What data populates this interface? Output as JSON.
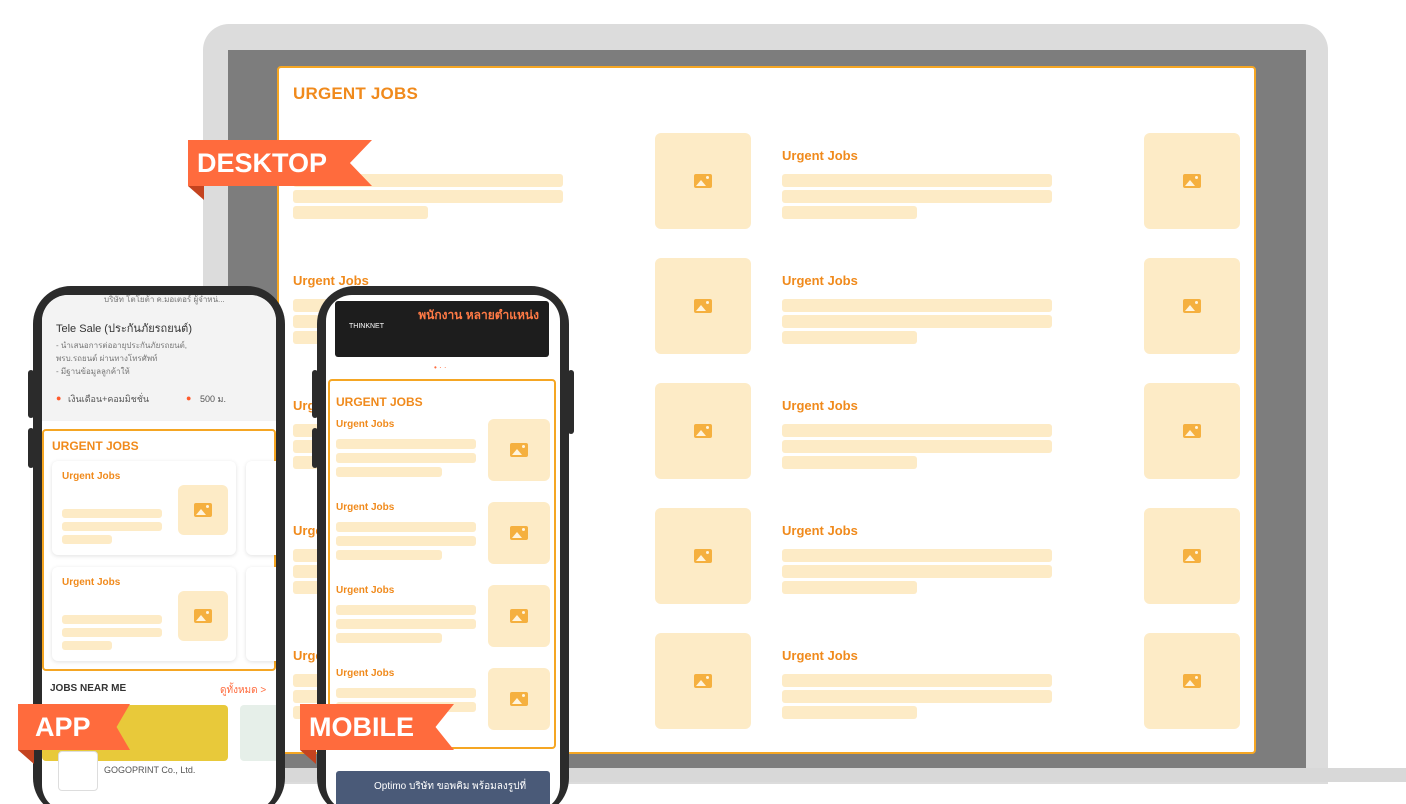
{
  "labels": {
    "desktop": "DESKTOP",
    "app": "APP",
    "mobile": "MOBILE"
  },
  "desktop": {
    "title": "URGENT JOBS",
    "card_label": "Urgent Jobs"
  },
  "app": {
    "company_line": "บริษัท โตโยต้า ค.มอเตอร์ ผู้จำหน่...",
    "job_title": "Tele Sale (ประกันภัยรถยนต์)",
    "job_desc": [
      "- นำเสนอการต่ออายุประกันภัยรถยนต์,",
      "พรบ.รถยนต์ ผ่านทางโทรศัพท์",
      "- มีฐานข้อมูลลูกค้าให้"
    ],
    "salary": "เงินเดือน+คอมมิชชั่น",
    "distance": "500 ม.",
    "urgent_title": "URGENT JOBS",
    "card_label": "Urgent Jobs",
    "near_title": "JOBS NEAR ME",
    "near_link": "ดูทั้งหมด >",
    "company": "GOGOPRINT Co., Ltd."
  },
  "mobile": {
    "banner_title": "พนักงาน หลายตำแหน่ง",
    "banner_brand": "THINKNET",
    "urgent_title": "URGENT JOBS",
    "card_label": "Urgent Jobs",
    "bottom_text": "Optimo บริษัท ขอพคิม พร้อมลงรูปที่"
  },
  "colors": {
    "accent": "#f08a1c",
    "ribbon": "#ff6b3d",
    "placeholder": "#fdebc6"
  }
}
